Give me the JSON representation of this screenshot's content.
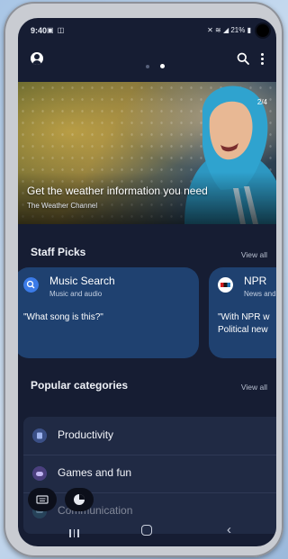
{
  "status_bar": {
    "time": "9:40",
    "battery": "21%"
  },
  "banner": {
    "title": "Get the weather information you need",
    "subtitle": "The Weather Channel",
    "counter": "2/4"
  },
  "staff_picks": {
    "title": "Staff Picks",
    "view_all": "View all",
    "cards": [
      {
        "title": "Music Search",
        "subtitle": "Music and audio",
        "quote": "\"What song is this?\""
      },
      {
        "title": "NPR",
        "subtitle": "News and",
        "quote": "\"With NPR w",
        "quote2": "Political new"
      }
    ]
  },
  "popular": {
    "title": "Popular categories",
    "view_all": "View all",
    "items": [
      {
        "label": "Productivity"
      },
      {
        "label": "Games and fun"
      },
      {
        "label": "Communication"
      }
    ]
  },
  "colors": {
    "background": "#161d33",
    "card": "#1f4170",
    "accent": "#3b7be8"
  }
}
